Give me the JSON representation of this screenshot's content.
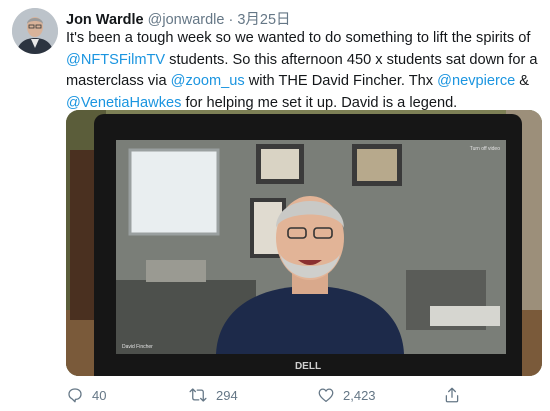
{
  "tweet": {
    "author_name": "Jon Wardle",
    "author_handle": "@jonwardle",
    "separator": "·",
    "date": "3月25日",
    "text_parts": {
      "p1": "It's been a tough week so we wanted to do something to lift the spirits of ",
      "m1": "@NFTSFilmTV",
      "p2": " students. So this afternoon 450 x students sat down for a masterclass via ",
      "m2": "@zoom_us",
      "p3": " with THE David Fincher. Thx ",
      "m3": "@nevpierce",
      "p4": " & ",
      "m4": "@VenetiaHawkes",
      "p5": " for helping me set it up. David is a legend."
    },
    "media": {
      "laptop_brand": "DELL",
      "zoom_label_top": "Turn off video",
      "zoom_label_bottom": "David Fincher"
    },
    "actions": {
      "reply_count": "40",
      "retweet_count": "294",
      "like_count": "2,423"
    }
  },
  "colors": {
    "link": "#1b95e0",
    "secondary_text": "#657786",
    "primary_text": "#14171a"
  },
  "icons": {
    "reply": "reply-icon",
    "retweet": "retweet-icon",
    "like": "heart-icon",
    "share": "share-icon"
  }
}
